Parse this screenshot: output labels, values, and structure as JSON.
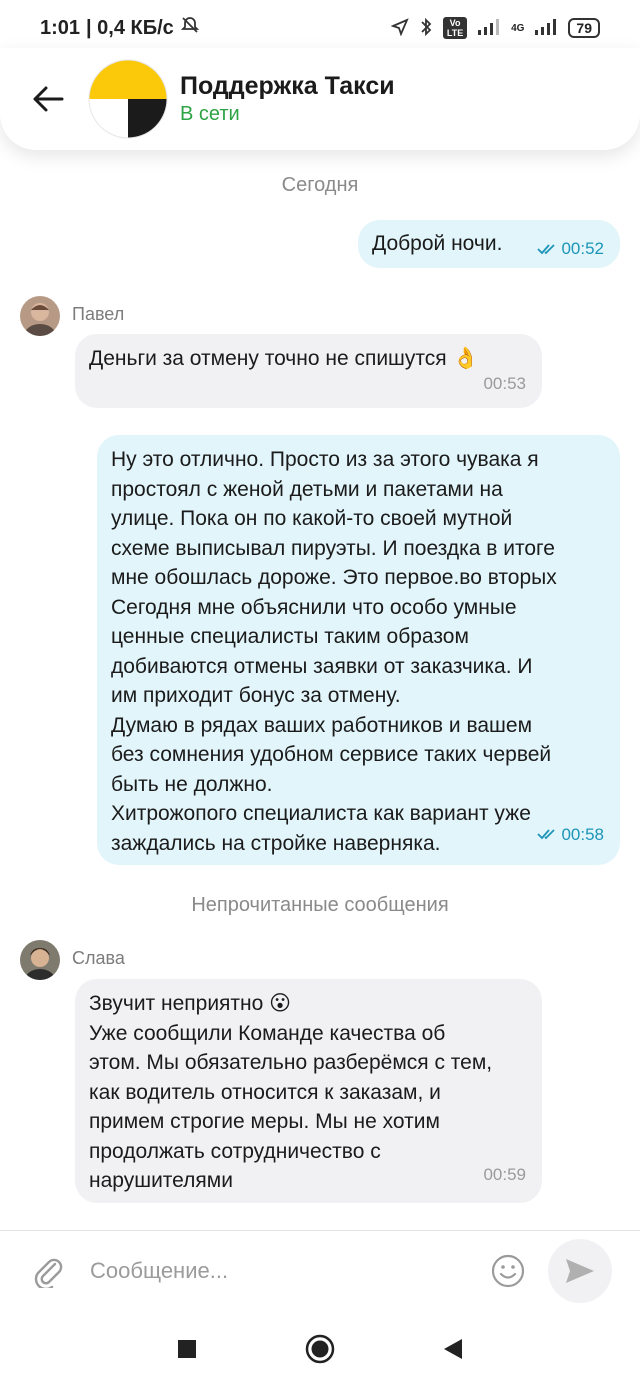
{
  "status_bar": {
    "time": "1:01",
    "speed": "| 0,4 КБ/с",
    "net_badge": "Vo LTE",
    "net_4g": "4G",
    "battery": "79"
  },
  "header": {
    "title": "Поддержка Такси",
    "status": "В сети"
  },
  "chat": {
    "date_divider": "Сегодня",
    "unread_divider": "Непрочитанные сообщения",
    "messages": [
      {
        "text": "Доброй ночи.",
        "time": "00:52"
      },
      {
        "sender": "Павел",
        "text": "Деньги за отмену точно не спишутся 👌",
        "time": "00:53"
      },
      {
        "lines": [
          "Ну это отлично. Просто из за этого чувака я",
          "простоял с женой детьми и пакетами на",
          "улице. Пока он по какой-то своей мутной",
          "схеме выписывал пируэты. И поездка в итоге",
          "мне обошлась дороже.  Это первое.во вторых",
          "Сегодня мне объяснили что особо умные",
          "ценные специалисты таким образом",
          "добиваются отмены заявки от заказчика. И",
          "им приходит бонус за отмену.",
          "Думаю в рядах ваших работников и вашем",
          "без сомнения удобном сервисе таких червей",
          "быть не должно.",
          "Хитрожопого специалиста как вариант уже",
          "заждались на стройке наверняка."
        ],
        "time": "00:58"
      },
      {
        "sender": "Слава",
        "lines": [
          "Звучит неприятно 😮",
          "Уже сообщили Команде качества об",
          "этом. Мы обязательно разберёмся с тем,",
          "как водитель относится к заказам, и",
          "примем строгие меры. Мы не хотим",
          "продолжать сотрудничество с",
          "нарушителями"
        ],
        "time": "00:59"
      }
    ]
  },
  "composer": {
    "placeholder": "Сообщение..."
  },
  "colors": {
    "online": "#2ea345",
    "outgoing_bubble": "#e2f5fb",
    "incoming_bubble": "#f1f1f3",
    "read_ticks": "#1c95b8",
    "brand_yellow": "#fcc80a"
  }
}
